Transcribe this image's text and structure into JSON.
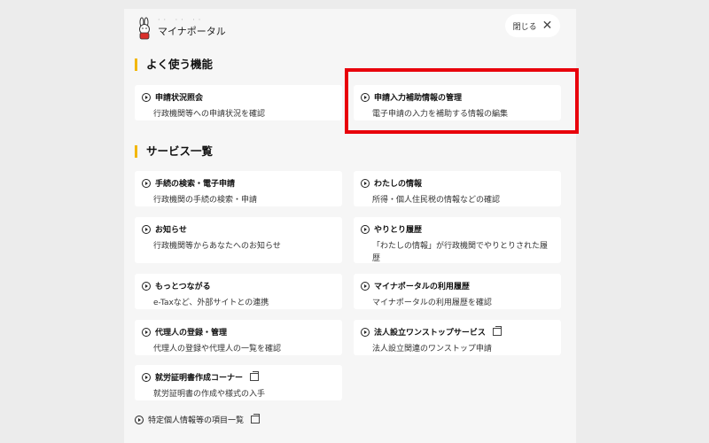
{
  "header": {
    "logo_text": "マイナポータル",
    "close_label": "閉じる"
  },
  "sections": {
    "frequent_title": "よく使う機能",
    "services_title": "サービス一覧"
  },
  "frequent": [
    {
      "title": "申請状況照会",
      "desc": "行政機関等への申請状況を確認"
    },
    {
      "title": "申請入力補助情報の管理",
      "desc": "電子申請の入力を補助する情報の編集"
    }
  ],
  "services": [
    {
      "title": "手続の検索・電子申請",
      "desc": "行政機関の手続の検索・申請"
    },
    {
      "title": "わたしの情報",
      "desc": "所得・個人住民税の情報などの確認"
    },
    {
      "title": "お知らせ",
      "desc": "行政機関等からあなたへのお知らせ"
    },
    {
      "title": "やりとり履歴",
      "desc": "「わたしの情報」が行政機関でやりとりされた履歴"
    },
    {
      "title": "もっとつながる",
      "desc": "e-Taxなど、外部サイトとの連携"
    },
    {
      "title": "マイナポータルの利用履歴",
      "desc": "マイナポータルの利用履歴を確認"
    },
    {
      "title": "代理人の登録・管理",
      "desc": "代理人の登録や代理人の一覧を確認"
    },
    {
      "title": "法人設立ワンストップサービス",
      "desc": "法人設立関連のワンストップ申請"
    },
    {
      "title": "就労証明書作成コーナー",
      "desc": "就労証明書の作成や様式の入手"
    }
  ],
  "bottom_link": "特定個人情報等の項目一覧"
}
